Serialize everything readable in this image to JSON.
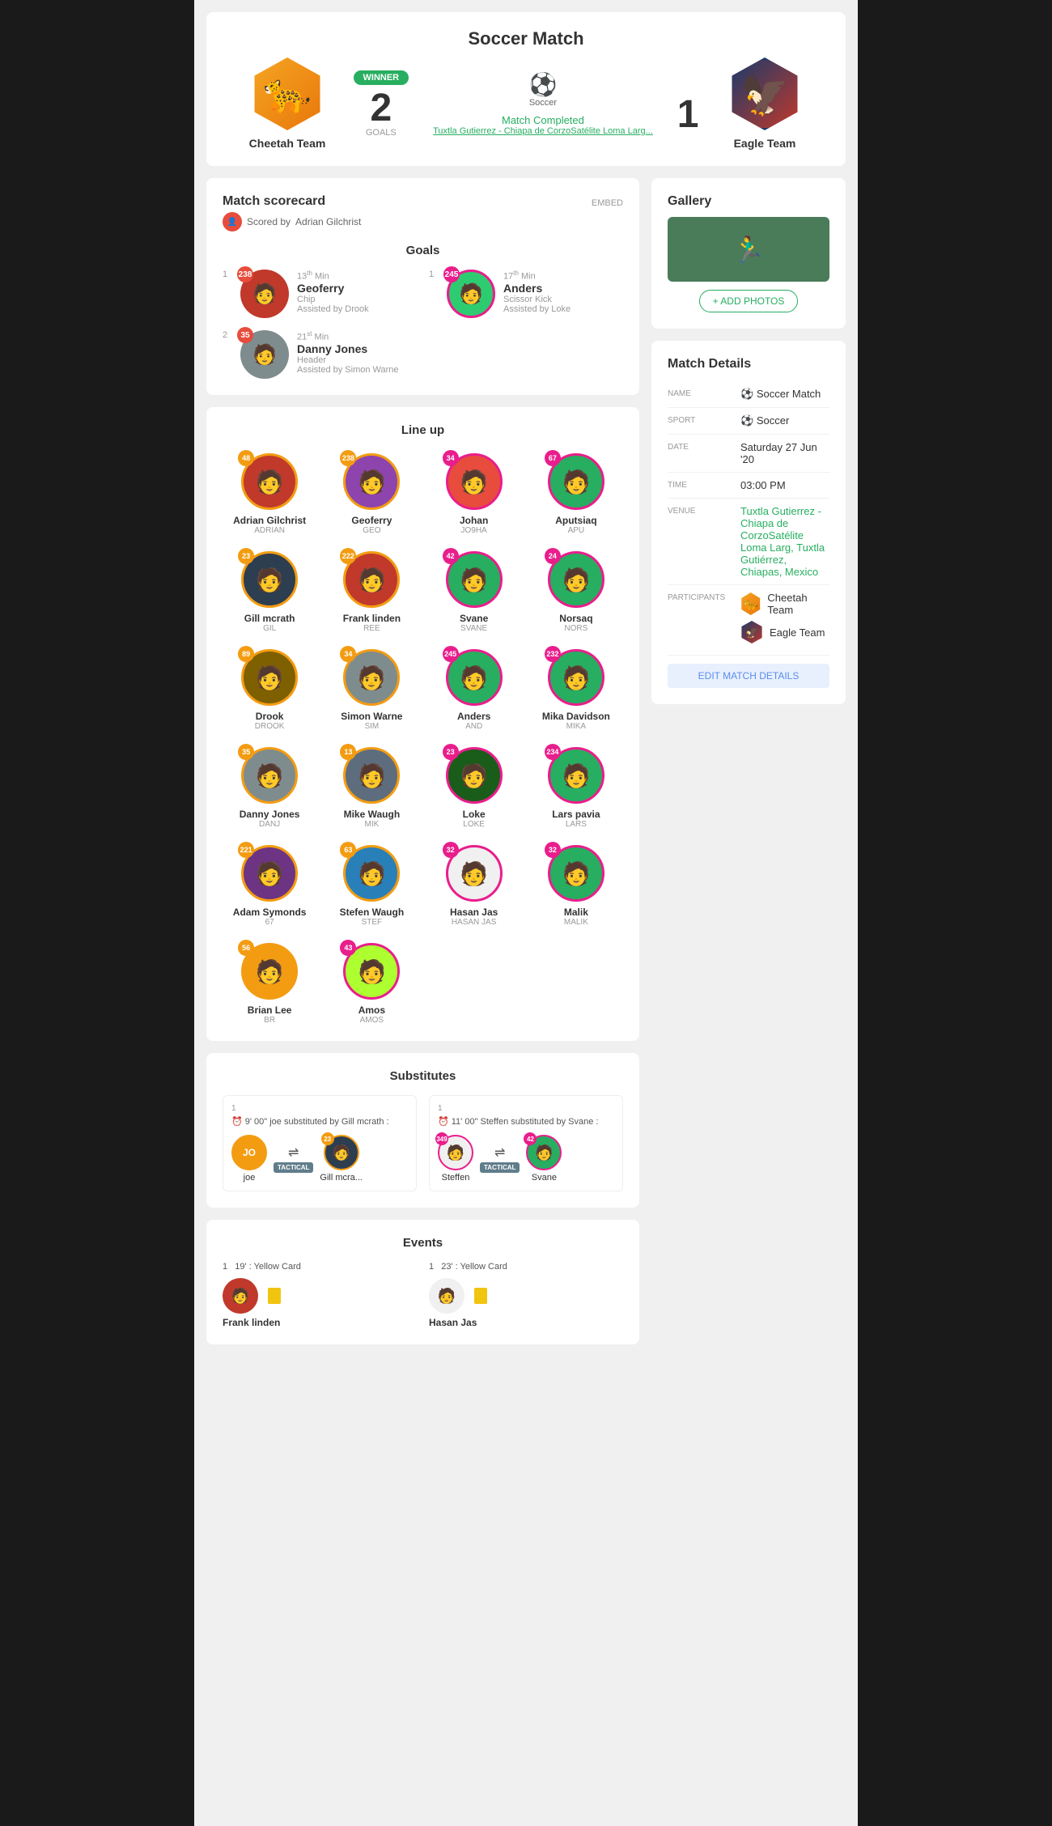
{
  "header": {
    "title": "Soccer Match",
    "sport": "Soccer",
    "status": "Match Completed",
    "venue": "Tuxtla Gutierrez - Chiapa de CorzoSatélite Loma Larg...",
    "left_team": {
      "name": "Cheetah Team",
      "score": "2",
      "score_label": "GOALS",
      "winner": true,
      "winner_label": "WINNER",
      "icon": "🐆"
    },
    "right_team": {
      "name": "Eagle Team",
      "score": "1",
      "icon": "🦅"
    }
  },
  "scorecard": {
    "title": "Match scorecard",
    "scored_by_label": "Scored by",
    "scorer": "Adrian Gilchrist",
    "embed_label": "EMBED",
    "goals_title": "Goals",
    "goals": [
      {
        "number": "1",
        "team": "cheetah",
        "minute": "13",
        "minute_suffix": "th",
        "name": "Geoferry",
        "type": "Chip",
        "assist": "Assisted by Drook",
        "badge": "238"
      },
      {
        "number": "1",
        "team": "eagle",
        "minute": "17",
        "minute_suffix": "th",
        "name": "Anders",
        "type": "Scissor Kick",
        "assist": "Assisted by Loke",
        "badge": "245"
      },
      {
        "number": "2",
        "team": "cheetah",
        "minute": "21",
        "minute_suffix": "st",
        "name": "Danny Jones",
        "type": "Header",
        "assist": "Assisted by Simon Warne",
        "badge": "35"
      }
    ]
  },
  "lineup": {
    "title": "Line up",
    "players": [
      {
        "name": "Adrian Gilchrist",
        "nick": "ADRIAN",
        "num": "48",
        "team": "cheetah",
        "icon": "🧑"
      },
      {
        "name": "Geoferry",
        "nick": "GEO",
        "num": "238",
        "team": "cheetah",
        "icon": "🧑"
      },
      {
        "name": "Johan",
        "nick": "JO9HA",
        "num": "34",
        "team": "eagle",
        "icon": "🧑"
      },
      {
        "name": "Aputsiaq",
        "nick": "APU",
        "num": "67",
        "team": "eagle",
        "icon": "🧑"
      },
      {
        "name": "Gill mcrath",
        "nick": "GIL",
        "num": "23",
        "team": "cheetah",
        "icon": "🧑"
      },
      {
        "name": "Frank linden",
        "nick": "REE",
        "num": "222",
        "team": "cheetah",
        "icon": "🧑"
      },
      {
        "name": "Svane",
        "nick": "SVANE",
        "num": "42",
        "team": "eagle",
        "icon": "🧑"
      },
      {
        "name": "Norsaq",
        "nick": "NORS",
        "num": "24",
        "team": "eagle",
        "icon": "🧑"
      },
      {
        "name": "Drook",
        "nick": "DROOK",
        "num": "89",
        "team": "cheetah",
        "icon": "🧑"
      },
      {
        "name": "Simon Warne",
        "nick": "SIM",
        "num": "34",
        "team": "cheetah",
        "icon": "🧑"
      },
      {
        "name": "Anders",
        "nick": "AND",
        "num": "245",
        "team": "eagle",
        "icon": "🧑"
      },
      {
        "name": "Mika Davidson",
        "nick": "MIKA",
        "num": "232",
        "team": "eagle",
        "icon": "🧑"
      },
      {
        "name": "Danny Jones",
        "nick": "DANJ",
        "num": "35",
        "team": "cheetah",
        "icon": "🧑"
      },
      {
        "name": "Mike Waugh",
        "nick": "MIK",
        "num": "13",
        "team": "cheetah",
        "icon": "🧑"
      },
      {
        "name": "Loke",
        "nick": "LOKE",
        "num": "23",
        "team": "eagle",
        "icon": "🧑"
      },
      {
        "name": "Lars pavia",
        "nick": "LARS",
        "num": "234",
        "team": "eagle",
        "icon": "🧑"
      },
      {
        "name": "Adam Symonds",
        "nick": "67",
        "num": "221",
        "team": "cheetah",
        "icon": "🧑"
      },
      {
        "name": "Stefen Waugh",
        "nick": "STEF",
        "num": "63",
        "team": "cheetah",
        "icon": "🧑"
      },
      {
        "name": "Hasan Jas",
        "nick": "HASAN JAS",
        "num": "32",
        "team": "eagle",
        "icon": "🧑"
      },
      {
        "name": "Malik",
        "nick": "MALIK",
        "num": "32",
        "team": "eagle",
        "icon": "🧑"
      },
      {
        "name": "Brian Lee",
        "nick": "BR",
        "num": "56",
        "team": "cheetah",
        "icon": "🧑"
      },
      {
        "name": "Amos",
        "nick": "AMOS",
        "num": "43",
        "team": "eagle",
        "icon": "🧑"
      }
    ]
  },
  "substitutes": {
    "title": "Substitutes",
    "items": [
      {
        "team_num": "1",
        "time": "9' 00\" joe substituted by Gill mcrath :",
        "out_player": "joe",
        "out_badge": "JO",
        "out_num": "",
        "in_player": "Gill mcra...",
        "in_num": "23",
        "tactical": "TACTICAL"
      },
      {
        "team_num": "1",
        "time": "11' 00\" Steffen substituted by Svane :",
        "out_player": "Steffen",
        "out_badge": "349",
        "out_num": "349",
        "in_player": "Svane",
        "in_num": "42",
        "tactical": "TACTICAL"
      }
    ]
  },
  "events": {
    "title": "Events",
    "items": [
      {
        "team_num": "1",
        "header": "19' : Yellow Card",
        "player": "Frank linden",
        "icon": "🧑"
      },
      {
        "team_num": "1",
        "header": "23' : Yellow Card",
        "player": "Hasan Jas",
        "icon": "🧑"
      }
    ]
  },
  "gallery": {
    "title": "Gallery",
    "add_photos_label": "+ ADD PHOTOS",
    "photo_icon": "🏃"
  },
  "match_details": {
    "title": "Match Details",
    "fields": {
      "name_label": "NAME",
      "name_value": "Soccer Match",
      "sport_label": "SPORT",
      "sport_value": "Soccer",
      "date_label": "DATE",
      "date_value": "Saturday 27 Jun '20",
      "time_label": "TIME",
      "time_value": "03:00 PM",
      "venue_label": "VENUE",
      "venue_value": "Tuxtla Gutierrez - Chiapa de CorzoSatélite Loma Larg, Tuxtla Gutiérrez, Chiapas, Mexico",
      "participants_label": "PARTICIPANTS",
      "team1": "Cheetah Team",
      "team2": "Eagle Team"
    },
    "edit_button": "EDIT MATCH DETAILS"
  }
}
